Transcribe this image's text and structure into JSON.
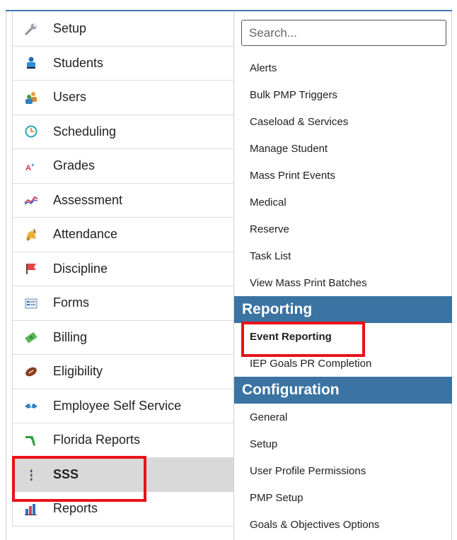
{
  "left_menu": {
    "items": [
      {
        "label": "Setup",
        "icon": "wrench-icon"
      },
      {
        "label": "Students",
        "icon": "student-icon"
      },
      {
        "label": "Users",
        "icon": "users-icon"
      },
      {
        "label": "Scheduling",
        "icon": "clock-icon"
      },
      {
        "label": "Grades",
        "icon": "grades-icon"
      },
      {
        "label": "Assessment",
        "icon": "line-chart-icon"
      },
      {
        "label": "Attendance",
        "icon": "bell-icon"
      },
      {
        "label": "Discipline",
        "icon": "flag-icon"
      },
      {
        "label": "Forms",
        "icon": "form-icon"
      },
      {
        "label": "Billing",
        "icon": "money-icon"
      },
      {
        "label": "Eligibility",
        "icon": "football-icon"
      },
      {
        "label": "Employee Self Service",
        "icon": "handshake-icon"
      },
      {
        "label": "Florida Reports",
        "icon": "florida-icon"
      },
      {
        "label": "SSS",
        "icon": "sss-icon"
      },
      {
        "label": "Reports",
        "icon": "bar-chart-icon"
      }
    ],
    "active": "SSS"
  },
  "search": {
    "placeholder": "Search..."
  },
  "submenu": {
    "items": [
      "Alerts",
      "Bulk PMP Triggers",
      "Caseload & Services",
      "Manage Student",
      "Mass Print Events",
      "Medical",
      "Reserve",
      "Task List",
      "View Mass Print Batches"
    ],
    "reporting": {
      "heading": "Reporting",
      "items": [
        "Event Reporting",
        "IEP Goals PR Completion"
      ]
    },
    "configuration": {
      "heading": "Configuration",
      "items": [
        "General",
        "Setup",
        "User Profile Permissions",
        "PMP Setup",
        "Goals & Objectives Options"
      ]
    }
  },
  "colors": {
    "section_header": "#3b73a3",
    "highlight": "#e8121b",
    "active_row": "#d9d9d9"
  }
}
